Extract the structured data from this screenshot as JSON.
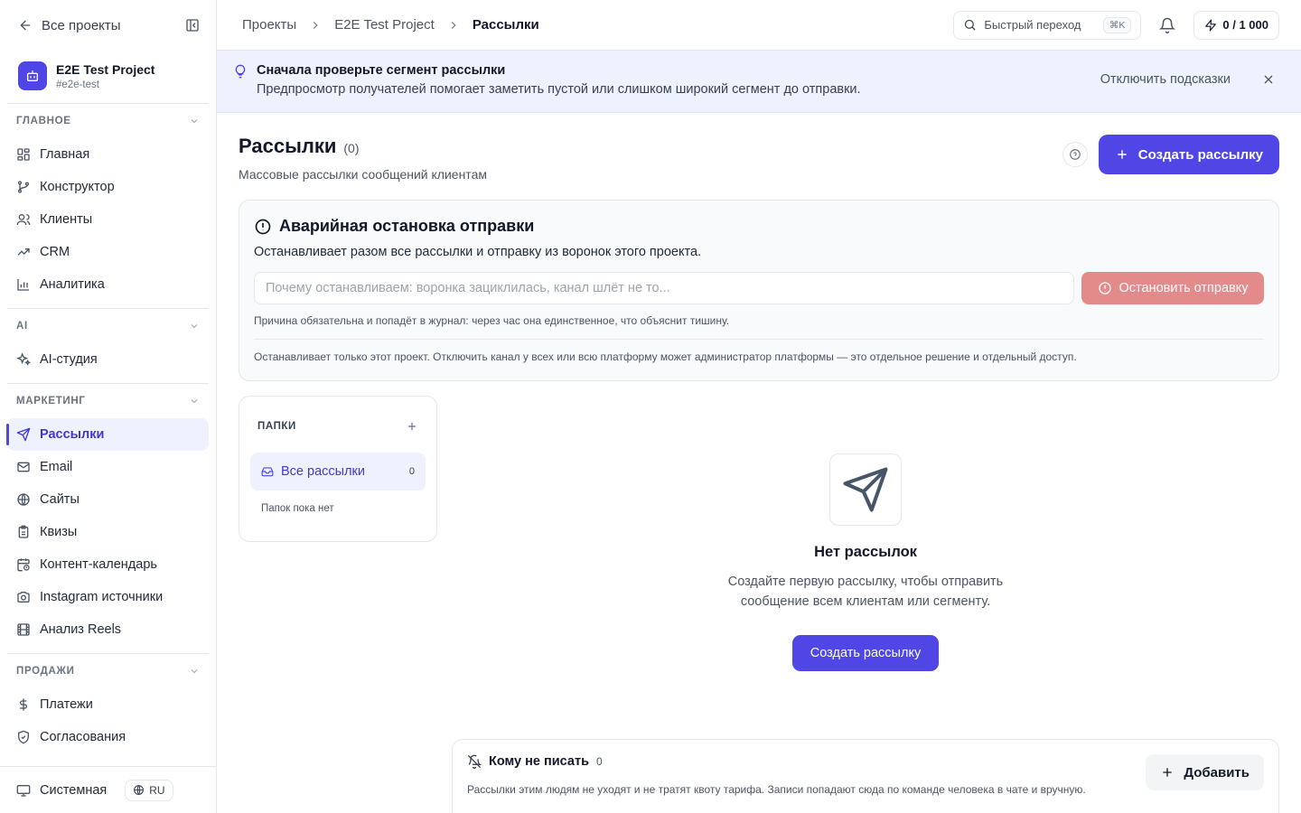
{
  "sidebar": {
    "back_label": "Все проекты",
    "project": {
      "name": "E2E Test Project",
      "slug": "#e2e-test"
    },
    "sections": [
      {
        "title": "Главное",
        "items": [
          {
            "label": "Главная",
            "icon": "layout-grid-icon"
          },
          {
            "label": "Конструктор",
            "icon": "git-branch-icon"
          },
          {
            "label": "Клиенты",
            "icon": "users-icon"
          },
          {
            "label": "CRM",
            "icon": "trending-up-icon"
          },
          {
            "label": "Аналитика",
            "icon": "bar-chart-icon"
          }
        ]
      },
      {
        "title": "AI",
        "items": [
          {
            "label": "AI-студия",
            "icon": "sparkles-icon"
          }
        ]
      },
      {
        "title": "Маркетинг",
        "items": [
          {
            "label": "Рассылки",
            "icon": "send-icon",
            "active": true
          },
          {
            "label": "Email",
            "icon": "mail-icon"
          },
          {
            "label": "Сайты",
            "icon": "globe-icon"
          },
          {
            "label": "Квизы",
            "icon": "clipboard-icon"
          },
          {
            "label": "Контент-календарь",
            "icon": "calendar-clock-icon"
          },
          {
            "label": "Instagram источники",
            "icon": "camera-icon"
          },
          {
            "label": "Анализ Reels",
            "icon": "film-icon"
          }
        ]
      },
      {
        "title": "Продажи",
        "items": [
          {
            "label": "Платежи",
            "icon": "dollar-icon"
          },
          {
            "label": "Согласования",
            "icon": "shield-check-icon"
          }
        ]
      }
    ],
    "theme_label": "Системная",
    "lang_label": "RU"
  },
  "header": {
    "breadcrumbs": [
      "Проекты",
      "E2E Test Project",
      "Рассылки"
    ],
    "quick_label": "Быстрый переход",
    "quick_shortcut": "⌘K",
    "quota": "0 / 1 000"
  },
  "hint": {
    "title": "Сначала проверьте сегмент рассылки",
    "text": "Предпросмотр получателей помогает заметить пустой или слишком широкий сегмент до отправки.",
    "disable_label": "Отключить подсказки"
  },
  "page": {
    "title": "Рассылки",
    "count": "(0)",
    "subtitle": "Массовые рассылки сообщений клиентам",
    "create_label": "Создать рассылку"
  },
  "emergency": {
    "title": "Аварийная остановка отправки",
    "description": "Останавливает разом все рассылки и отправку из воронок этого проекта.",
    "placeholder": "Почему останавливаем: воронка зациклилась, канал шлёт не то...",
    "button_label": "Остановить отправку",
    "note": "Причина обязательна и попадёт в журнал: через час она единственное, что объяснит тишину.",
    "footer": "Останавливает только этот проект. Отключить канал у всех или всю платформу может администратор платформы — это отдельное решение и отдельный доступ."
  },
  "folders": {
    "title": "Папки",
    "all_label": "Все рассылки",
    "all_count": "0",
    "empty_text": "Папок пока нет"
  },
  "empty_state": {
    "title": "Нет рассылок",
    "text": "Создайте первую рассылку, чтобы отправить сообщение всем клиентам или сегменту.",
    "button_label": "Создать рассылку"
  },
  "do_not_contact": {
    "title": "Кому не писать",
    "count": "0",
    "add_label": "Добавить",
    "text": "Рассылки этим людям не уходят и не тратят квоту тарифа. Записи попадают сюда по команде человека в чате и вручную."
  },
  "colors": {
    "accent": "#4f46e5",
    "accent_soft": "#eef2ff",
    "danger_soft": "#e38a8a"
  }
}
